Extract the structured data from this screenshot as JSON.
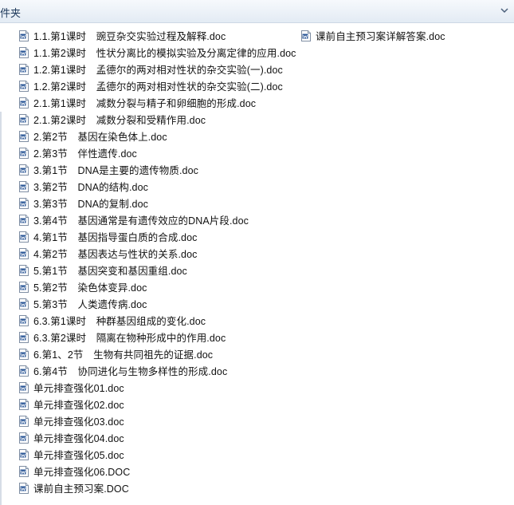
{
  "header": {
    "title": "件夹"
  },
  "column1": [
    "1.1.第1课时　豌豆杂交实验过程及解释.doc",
    "1.1.第2课时　性状分离比的模拟实验及分离定律的应用.doc",
    "1.2.第1课时　孟德尔的两对相对性状的杂交实验(一).doc",
    "1.2.第2课时　孟德尔的两对相对性状的杂交实验(二).doc",
    "2.1.第1课时　减数分裂与精子和卵细胞的形成.doc",
    "2.1.第2课时　减数分裂和受精作用.doc",
    "2.第2节　基因在染色体上.doc",
    "2.第3节　伴性遗传.doc",
    "3.第1节　DNA是主要的遗传物质.doc",
    "3.第2节　DNA的结构.doc",
    "3.第3节　DNA的复制.doc",
    "3.第4节　基因通常是有遗传效应的DNA片段.doc",
    "4.第1节　基因指导蛋白质的合成.doc",
    "4.第2节　基因表达与性状的关系.doc",
    "5.第1节　基因突变和基因重组.doc",
    "5.第2节　染色体变异.doc",
    "5.第3节　人类遗传病.doc",
    "6.3.第1课时　种群基因组成的变化.doc",
    "6.3.第2课时　隔离在物种形成中的作用.doc",
    "6.第1、2节　生物有共同祖先的证据.doc",
    "6.第4节　协同进化与生物多样性的形成.doc",
    "单元排查强化01.doc",
    "单元排查强化02.doc",
    "单元排查强化03.doc",
    "单元排查强化04.doc",
    "单元排查强化05.doc",
    "单元排查强化06.DOC",
    "课前自主预习案.DOC"
  ],
  "column2": [
    "课前自主预习案详解答案.doc"
  ],
  "icons": {
    "file": "word-document-icon",
    "chevron": "chevron-down-icon"
  },
  "colors": {
    "icon_blue": "#2b5797",
    "text": "#111111"
  }
}
